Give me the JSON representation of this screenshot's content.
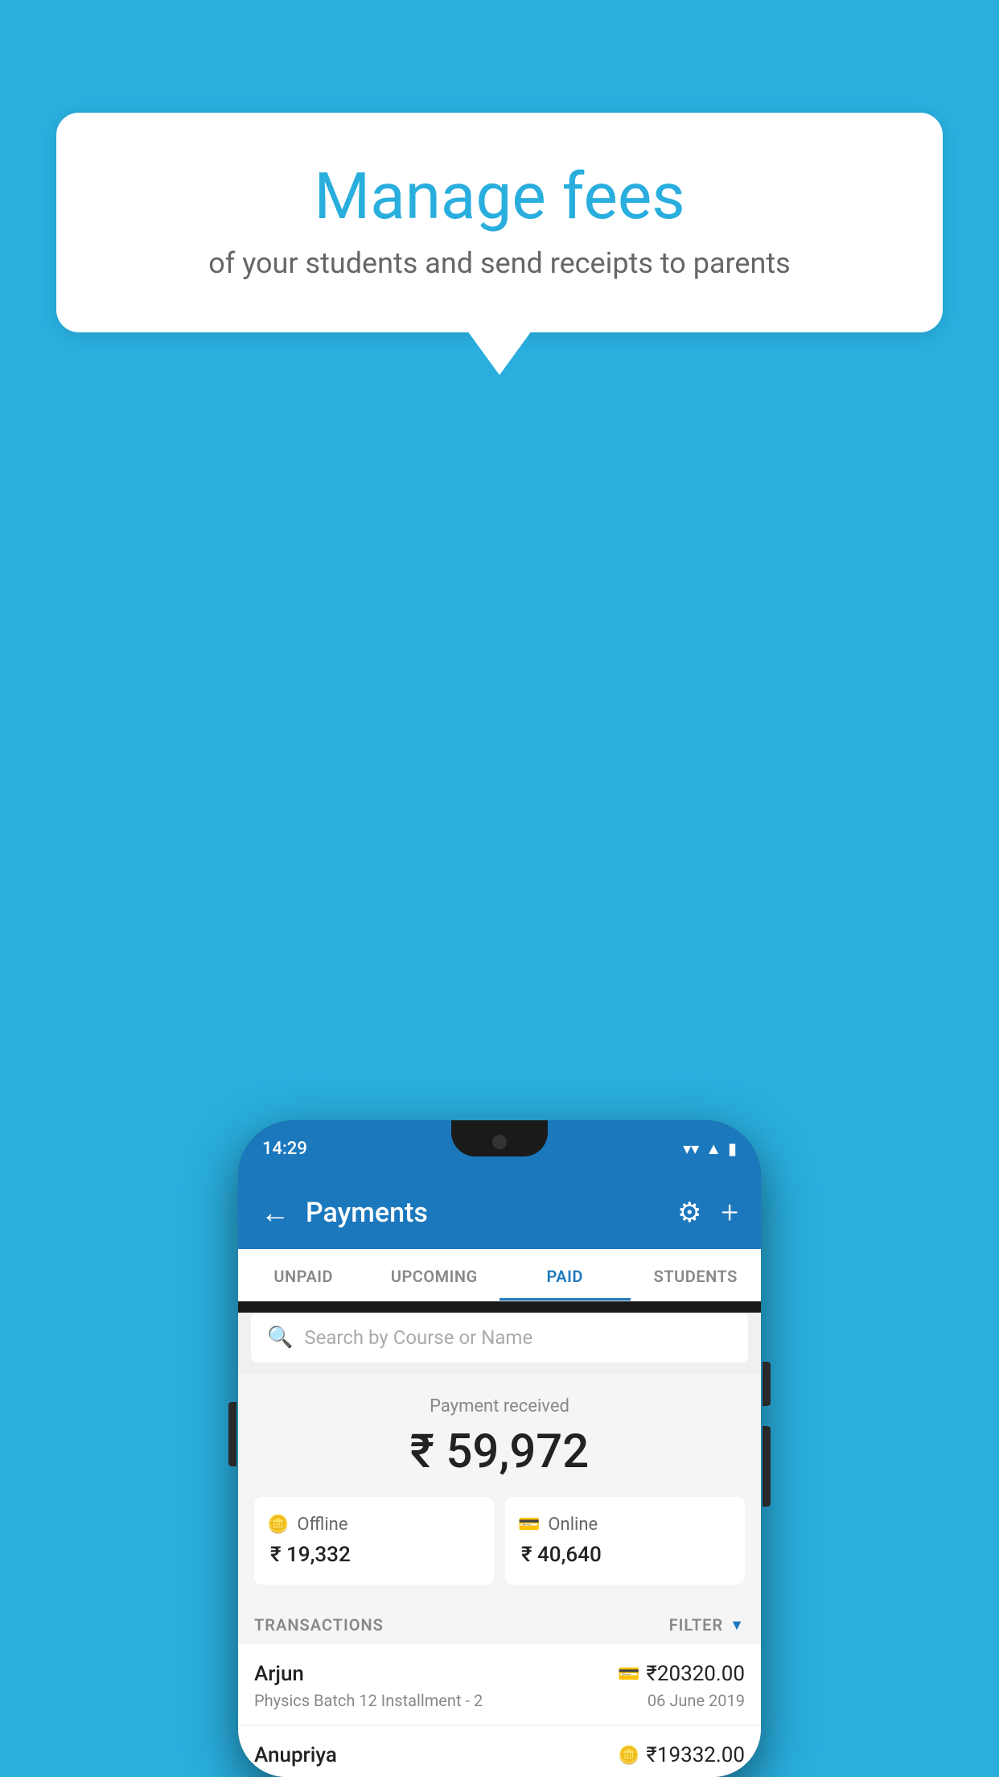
{
  "background_color": "#29AEDE",
  "speech_bubble": {
    "title": "Manage fees",
    "subtitle": "of your students and send receipts to parents"
  },
  "phone": {
    "status_bar": {
      "time": "14:29"
    },
    "header": {
      "title": "Payments",
      "back_label": "←",
      "gear_label": "⚙",
      "plus_label": "+"
    },
    "tabs": [
      {
        "label": "UNPAID",
        "active": false
      },
      {
        "label": "UPCOMING",
        "active": false
      },
      {
        "label": "PAID",
        "active": true
      },
      {
        "label": "STUDENTS",
        "active": false
      }
    ],
    "search": {
      "placeholder": "Search by Course or Name"
    },
    "payment_received": {
      "label": "Payment received",
      "amount": "₹ 59,972",
      "offline": {
        "label": "Offline",
        "amount": "₹ 19,332"
      },
      "online": {
        "label": "Online",
        "amount": "₹ 40,640"
      }
    },
    "transactions": {
      "label": "TRANSACTIONS",
      "filter_label": "FILTER",
      "items": [
        {
          "name": "Arjun",
          "amount": "₹20320.00",
          "detail": "Physics Batch 12 Installment - 2",
          "date": "06 June 2019",
          "type": "online"
        },
        {
          "name": "Anupriya",
          "amount": "₹19332.00",
          "type": "offline",
          "partial": true
        }
      ]
    }
  }
}
